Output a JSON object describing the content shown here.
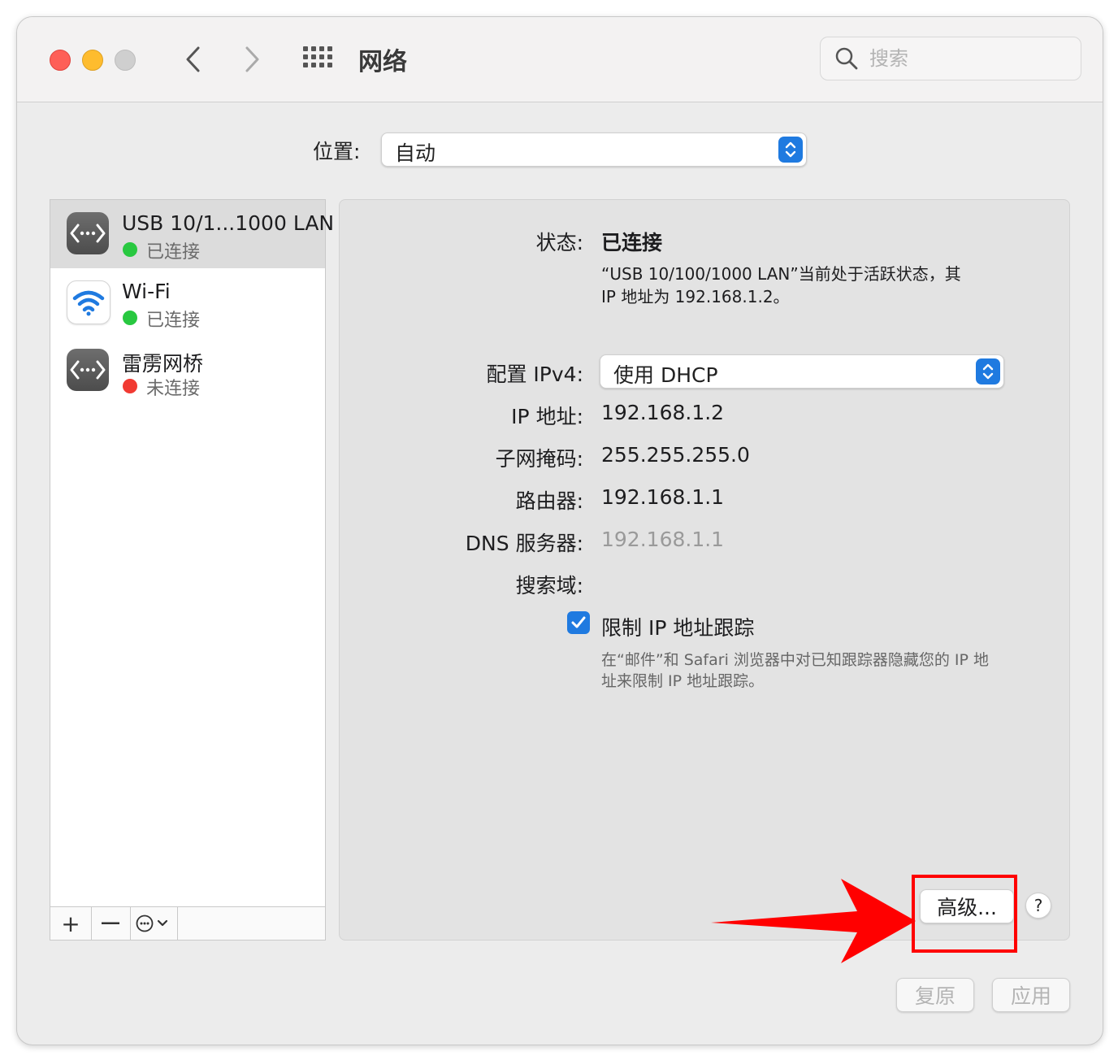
{
  "window": {
    "title": "网络",
    "search_placeholder": "搜索"
  },
  "location": {
    "label": "位置:",
    "value": "自动"
  },
  "services": [
    {
      "name": "USB 10/1...1000 LAN",
      "status": "已连接",
      "status_color": "#28c840",
      "icon": "ethernet-icon",
      "selected": true
    },
    {
      "name": "Wi-Fi",
      "status": "已连接",
      "status_color": "#28c840",
      "icon": "wifi-icon",
      "selected": false
    },
    {
      "name": "雷雳网桥",
      "status": "未连接",
      "status_color": "#f13a32",
      "icon": "ethernet-icon",
      "selected": false
    }
  ],
  "sidebar_toolbar": {
    "add": "+",
    "remove": "—"
  },
  "detail": {
    "status_label": "状态:",
    "status_value": "已连接",
    "status_desc_line1": "“USB 10/100/1000 LAN”当前处于活跃状态，其",
    "status_desc_line2": "IP 地址为 192.168.1.2。",
    "ipv4_label": "配置 IPv4:",
    "ipv4_value": "使用 DHCP",
    "ip_label": "IP 地址:",
    "ip_value": "192.168.1.2",
    "subnet_label": "子网掩码:",
    "subnet_value": "255.255.255.0",
    "router_label": "路由器:",
    "router_value": "192.168.1.1",
    "dns_label": "DNS 服务器:",
    "dns_value": "192.168.1.1",
    "search_domain_label": "搜索域:",
    "limit_tracking_label": "限制 IP 地址跟踪",
    "limit_tracking_checked": true,
    "limit_desc_line1": "在“邮件”和 Safari 浏览器中对已知跟踪器隐藏您的 IP 地",
    "limit_desc_line2": "址来限制 IP 地址跟踪。",
    "advanced_button": "高级...",
    "help_button": "?"
  },
  "footer": {
    "revert_button": "复原",
    "apply_button": "应用"
  },
  "colors": {
    "accent": "#1f7ae0",
    "annotation": "#ff0000"
  }
}
